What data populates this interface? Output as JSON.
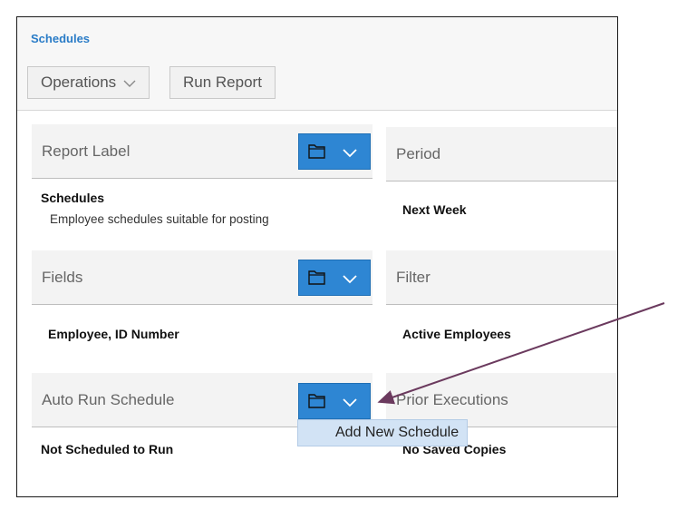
{
  "header": {
    "title": "Schedules"
  },
  "toolbar": {
    "operations_label": "Operations",
    "run_report_label": "Run Report"
  },
  "cards": {
    "report_label": {
      "label": "Report Label",
      "value": "Schedules",
      "description": "Employee schedules suitable for posting"
    },
    "period": {
      "label": "Period",
      "value": "Next Week"
    },
    "fields": {
      "label": "Fields",
      "value": "Employee, ID Number"
    },
    "filter": {
      "label": "Filter",
      "value": "Active Employees"
    },
    "auto_run_schedule": {
      "label": "Auto Run Schedule",
      "value": "Not Scheduled to Run"
    },
    "prior_executions": {
      "label": "Prior Executions",
      "value": "No Saved Copies"
    }
  },
  "dropdown": {
    "add_new_schedule": "Add New Schedule"
  },
  "colors": {
    "accent": "#2e86d3",
    "title": "#2a7cc7",
    "annotation_arrow": "#6b3a5e",
    "dropdown_bg": "#d2e3f5"
  },
  "icons": [
    "chevron-down-icon",
    "folder-icon"
  ]
}
